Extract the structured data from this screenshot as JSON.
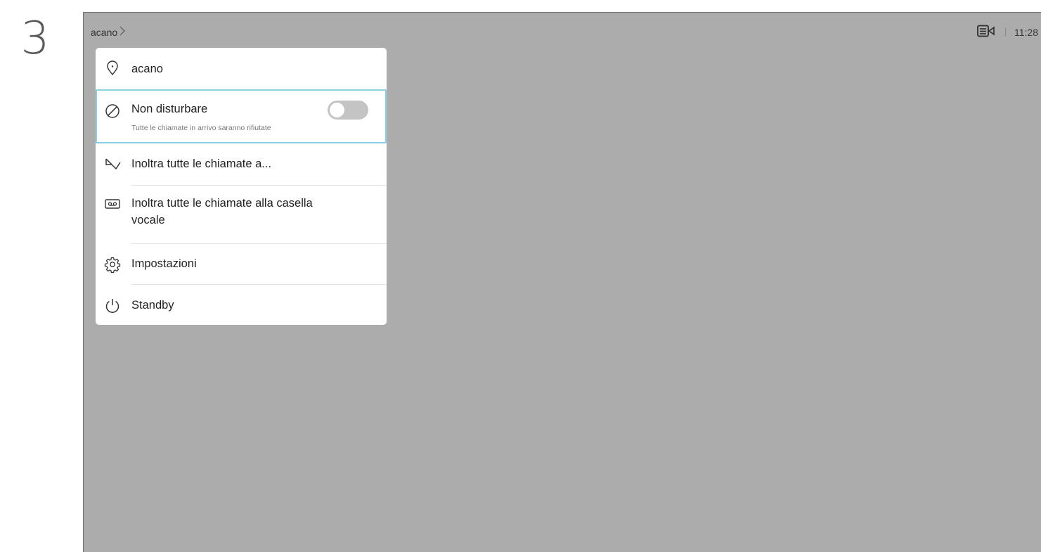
{
  "step": "3",
  "header": {
    "breadcrumb": "acano",
    "time": "11:28",
    "icons": {
      "breadcrumb_chevron": "chevron-right-icon",
      "camera": "video-layout-icon"
    }
  },
  "menu": {
    "items": [
      {
        "label": "acano",
        "icon": "location-pin-icon"
      },
      {
        "label": "Non disturbare",
        "sublabel": "Tutte le chiamate in arrivo saranno rifiutate",
        "icon": "block-icon",
        "toggle_on": false,
        "focused": true
      },
      {
        "label": "Inoltra tutte le chiamate a...",
        "icon": "forward-arrow-icon"
      },
      {
        "label_line1": "Inoltra tutte le chiamate alla casella",
        "label_line2": "vocale",
        "icon": "voicemail-icon"
      },
      {
        "label": "Impostazioni",
        "icon": "gear-icon"
      },
      {
        "label": "Standby",
        "icon": "power-icon"
      }
    ]
  },
  "colors": {
    "screen_bg": "#acacac",
    "focus_border": "#8ccfe5",
    "toggle_off": "#c4c4c4"
  }
}
